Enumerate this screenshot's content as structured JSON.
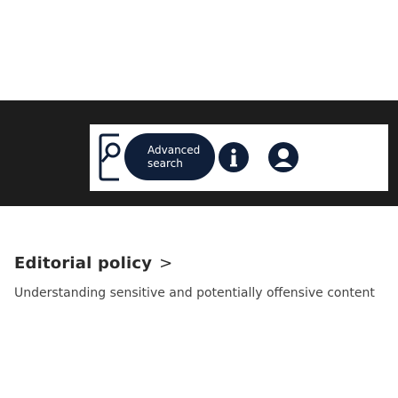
{
  "header": {
    "advanced_search_line1": "Advanced",
    "advanced_search_line2": "search",
    "icons": {
      "search": "search-icon",
      "info": "info-icon",
      "user": "user-icon"
    },
    "colors": {
      "bar": "#1d1d1d",
      "button": "#0f1f3a"
    }
  },
  "section": {
    "heading": "Editorial policy",
    "chevron": ">",
    "description": "Understanding sensitive and potentially offensive content"
  }
}
